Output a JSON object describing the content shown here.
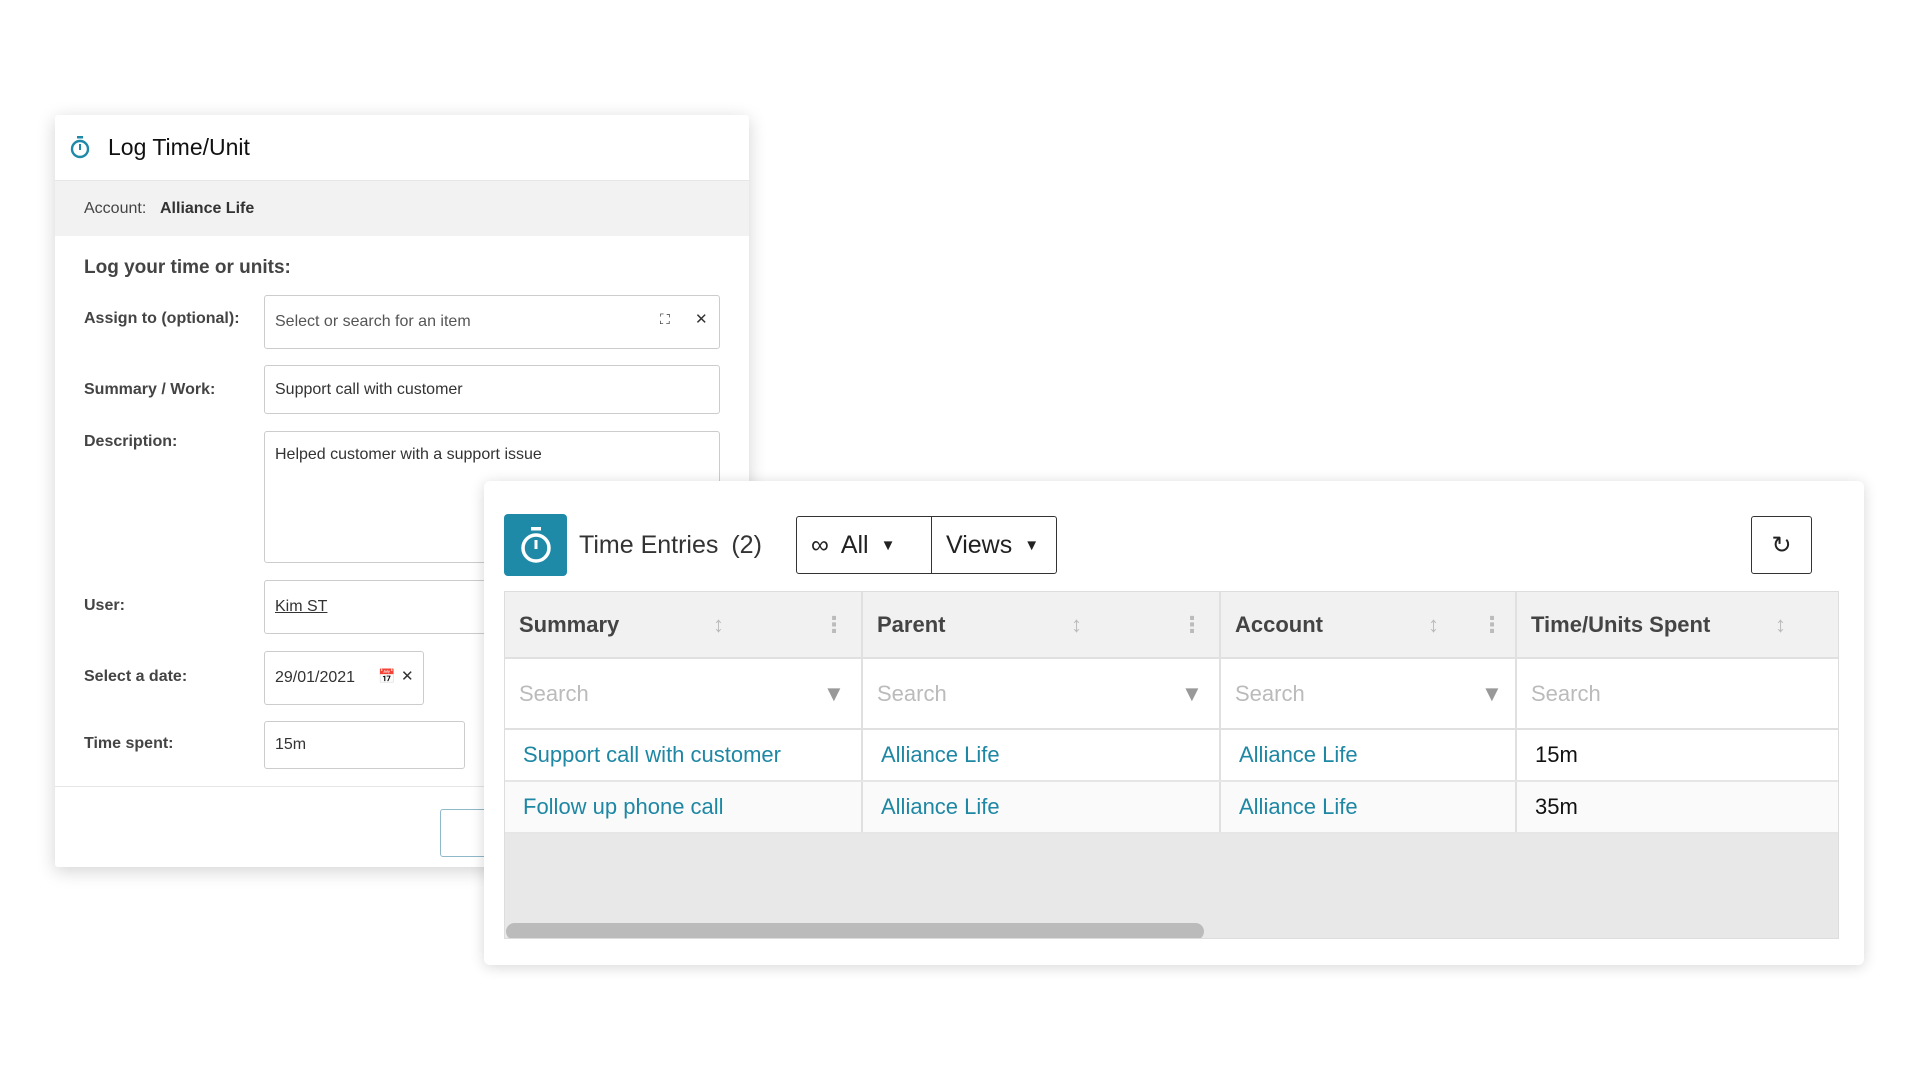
{
  "log_form": {
    "title": "Log Time/Unit",
    "title_icon": "stopwatch-icon",
    "account_label": "Account:",
    "account_value": "Alliance Life",
    "heading": "Log your time or units:",
    "fields": {
      "assign_label": "Assign to (optional):",
      "assign_placeholder": "Select or search for an item",
      "summary_label": "Summary / Work:",
      "summary_value": "Support call with customer",
      "description_label": "Description:",
      "description_value": "Helped customer with a support issue",
      "user_label": "User:",
      "user_value": "Kim ST",
      "date_label": "Select a date:",
      "date_value": "29/01/2021",
      "time_label": "Time spent:",
      "time_value": "15m"
    }
  },
  "time_entries": {
    "title": "Time Entries",
    "count": "(2)",
    "filter_label": "All",
    "views_label": "Views",
    "columns": [
      "Summary",
      "Parent",
      "Account",
      "Time/Units Spent"
    ],
    "search_placeholder": "Search",
    "rows": [
      {
        "summary": "Support call with customer",
        "parent": "Alliance Life",
        "account": "Alliance Life",
        "time": "15m"
      },
      {
        "summary": "Follow up phone call",
        "parent": "Alliance Life",
        "account": "Alliance Life",
        "time": "35m"
      }
    ],
    "accent_color": "#1e8aa8"
  }
}
